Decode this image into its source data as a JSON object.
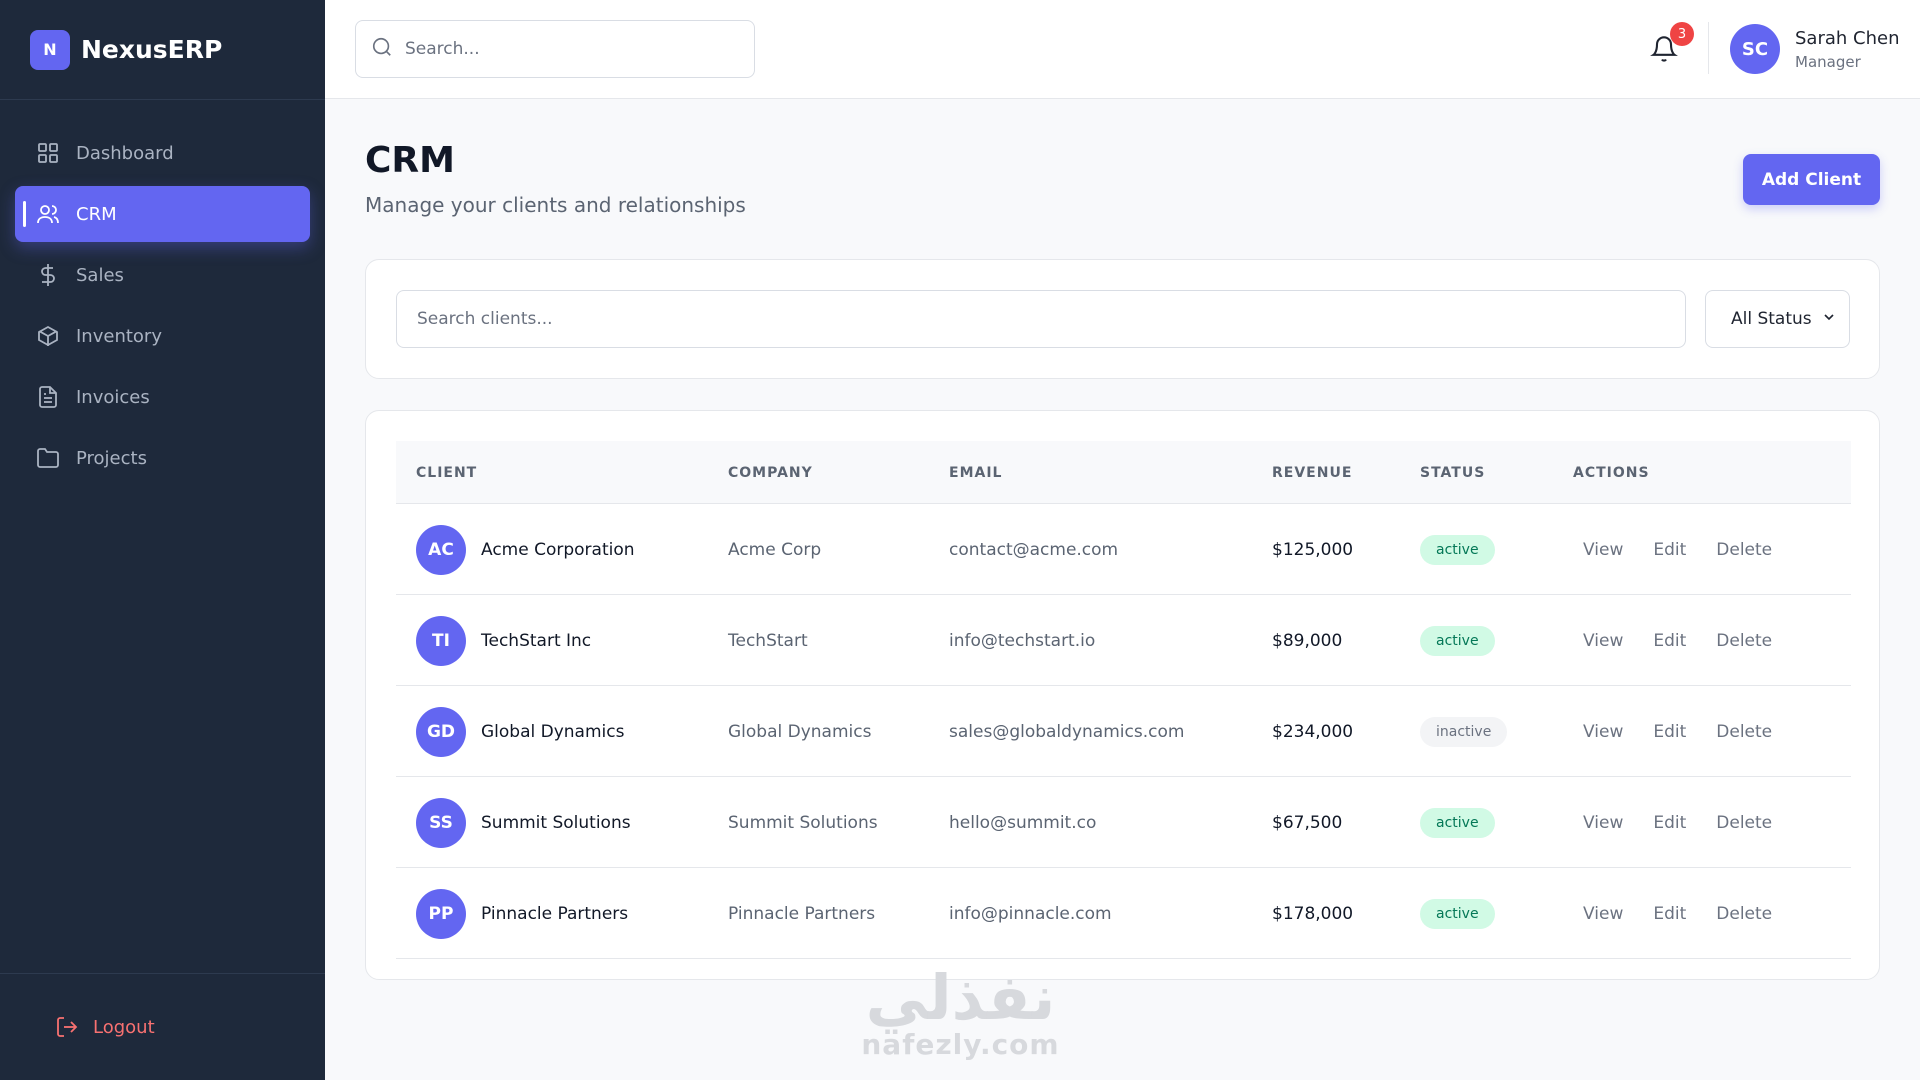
{
  "brand": {
    "logo_letter": "N",
    "name": "NexusERP"
  },
  "nav": {
    "items": [
      {
        "label": "Dashboard",
        "icon": "grid-icon"
      },
      {
        "label": "CRM",
        "icon": "users-icon",
        "active": true
      },
      {
        "label": "Sales",
        "icon": "dollar-icon"
      },
      {
        "label": "Inventory",
        "icon": "box-icon"
      },
      {
        "label": "Invoices",
        "icon": "file-text-icon"
      },
      {
        "label": "Projects",
        "icon": "folder-icon"
      }
    ],
    "logout_label": "Logout"
  },
  "header": {
    "search_placeholder": "Search...",
    "notification_count": "3",
    "user": {
      "initials": "SC",
      "name": "Sarah Chen",
      "role": "Manager"
    }
  },
  "page": {
    "title": "CRM",
    "subtitle": "Manage your clients and relationships",
    "add_button": "Add Client"
  },
  "filters": {
    "search_placeholder": "Search clients...",
    "status_selected": "All Status"
  },
  "table": {
    "columns": [
      "CLIENT",
      "COMPANY",
      "EMAIL",
      "REVENUE",
      "STATUS",
      "ACTIONS"
    ],
    "actions": [
      "View",
      "Edit",
      "Delete"
    ],
    "rows": [
      {
        "initials": "AC",
        "client": "Acme Corporation",
        "company": "Acme Corp",
        "email": "contact@acme.com",
        "revenue": "$125,000",
        "status": "active"
      },
      {
        "initials": "TI",
        "client": "TechStart Inc",
        "company": "TechStart",
        "email": "info@techstart.io",
        "revenue": "$89,000",
        "status": "active"
      },
      {
        "initials": "GD",
        "client": "Global Dynamics",
        "company": "Global Dynamics",
        "email": "sales@globaldynamics.com",
        "revenue": "$234,000",
        "status": "inactive"
      },
      {
        "initials": "SS",
        "client": "Summit Solutions",
        "company": "Summit Solutions",
        "email": "hello@summit.co",
        "revenue": "$67,500",
        "status": "active"
      },
      {
        "initials": "PP",
        "client": "Pinnacle Partners",
        "company": "Pinnacle Partners",
        "email": "info@pinnacle.com",
        "revenue": "$178,000",
        "status": "active"
      }
    ]
  },
  "watermark": {
    "arabic": "نفذلي",
    "latin": "nafezly.com"
  },
  "colors": {
    "accent": "#6366f1",
    "sidebar": "#1e293b",
    "danger": "#ef4444",
    "success_bg": "#d1fae5",
    "success_text": "#047857"
  }
}
